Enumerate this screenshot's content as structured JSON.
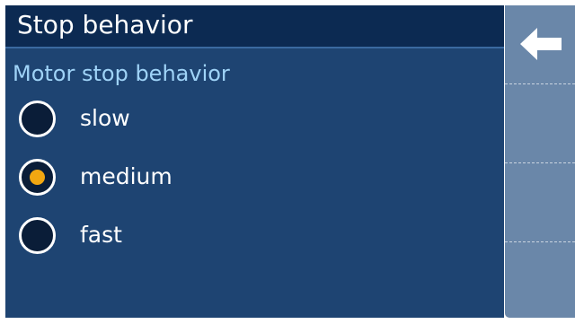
{
  "header": {
    "title": "Stop behavior"
  },
  "section": {
    "label": "Motor stop behavior"
  },
  "options": [
    {
      "label": "slow",
      "selected": false
    },
    {
      "label": "medium",
      "selected": true
    },
    {
      "label": "fast",
      "selected": false
    }
  ],
  "sidebar": {
    "back_icon": "arrow-left-icon"
  },
  "colors": {
    "panel_background": "#1e4472",
    "title_background": "#0c2a52",
    "section_label": "#9fd3f7",
    "selected_dot": "#f2a711",
    "sidebar_background": "#6a87a9"
  }
}
